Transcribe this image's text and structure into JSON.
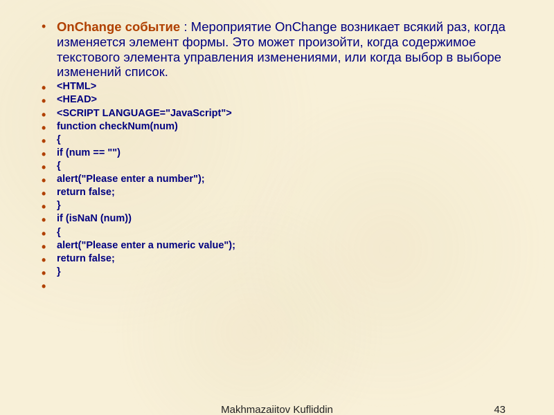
{
  "header": {
    "title_strong": "OnChange событие",
    "title_rest": " : Мероприятие OnChange возникает всякий раз, когда изменяется элемент формы. Это может произойти, когда содержимое текстового элемента управления изменениями, или когда выбор в выборе изменений список."
  },
  "code_lines": [
    "<HTML>",
    "<HEAD>",
    " <SCRIPT LANGUAGE=\"JavaScript\">",
    "function checkNum(num)",
    "  {",
    "   if (num == \"\")",
    "   {",
    "  alert(\"Please enter a number\");",
    "  return false;",
    "   }",
    "if (isNaN (num))",
    "{",
    "alert(\"Please enter a numeric value\");",
    "return false;",
    "}",
    ""
  ],
  "footer": {
    "author": "Makhmazaiitov Kufliddin",
    "page": "43"
  }
}
